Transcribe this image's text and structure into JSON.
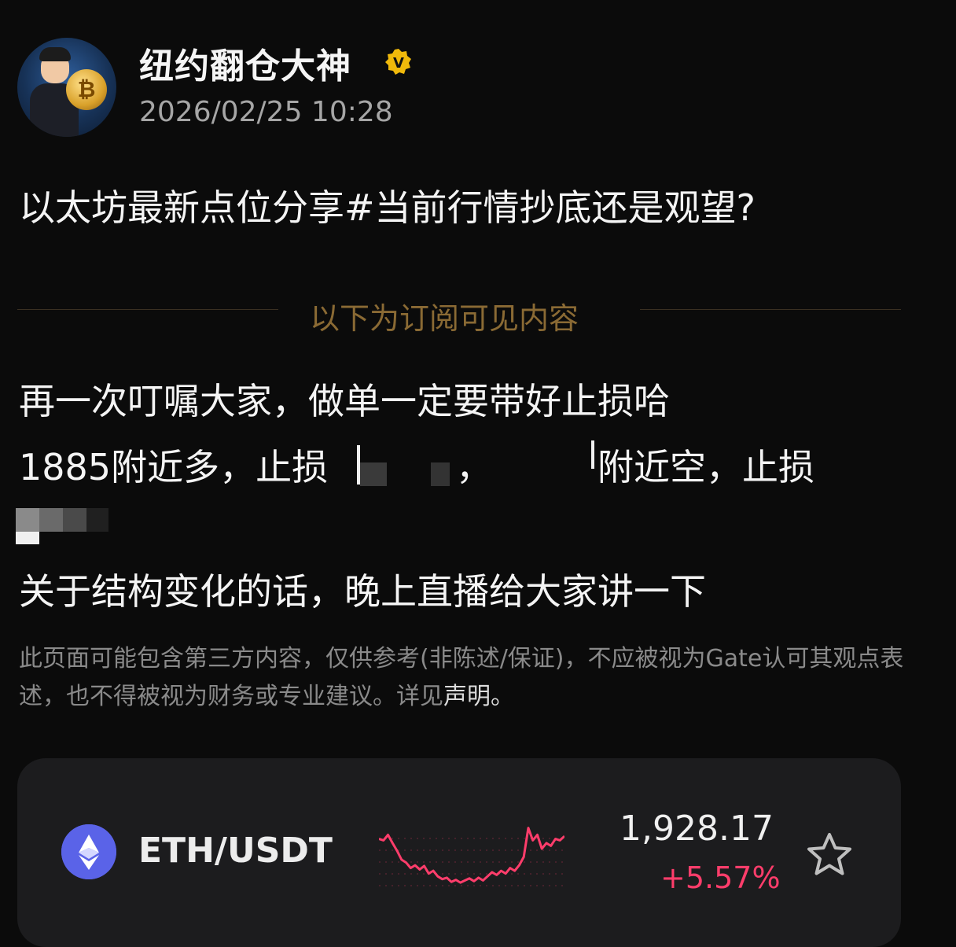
{
  "author": {
    "name": "纽约翻仓大神",
    "avatar_icon": "avatar-cartoon-bitcoin",
    "verified_icon": "verified-badge-icon",
    "verified_letter": "V",
    "verified_color": "#f0b90b",
    "timestamp": "2026/02/25 10:28"
  },
  "post": {
    "title": "以太坊最新点位分享#当前行情抄底还是观望?",
    "subscriber_divider": "以下为订阅可见内容",
    "line1": "再一次叮嘱大家，做单一定要带好止损哈",
    "line2_part1": "1885附近多，止损",
    "line2_comma": "，",
    "line2_part2": "附近空，止损",
    "line4": "关于结构变化的话，晚上直播给大家讲一下",
    "disclaimer_text": "此页面可能包含第三方内容，仅供参考(非陈述/保证)，不应被视为Gate认可其观点表述，也不得被视为财务或专业建议。详见",
    "disclaimer_link": "声明。"
  },
  "ticker": {
    "icon": "ethereum-icon",
    "pair": "ETH/USDT",
    "price": "1,928.17",
    "change": "+5.57%",
    "change_color": "#ff3d6b",
    "sparkline": [
      0.72,
      0.7,
      0.78,
      0.66,
      0.55,
      0.42,
      0.38,
      0.3,
      0.34,
      0.28,
      0.33,
      0.22,
      0.26,
      0.18,
      0.14,
      0.16,
      0.1,
      0.13,
      0.09,
      0.12,
      0.15,
      0.11,
      0.16,
      0.12,
      0.18,
      0.24,
      0.2,
      0.26,
      0.22,
      0.3,
      0.26,
      0.34,
      0.46,
      0.88,
      0.7,
      0.78,
      0.58,
      0.66,
      0.62,
      0.72,
      0.7,
      0.76
    ],
    "favorite_icon": "star-outline-icon"
  }
}
